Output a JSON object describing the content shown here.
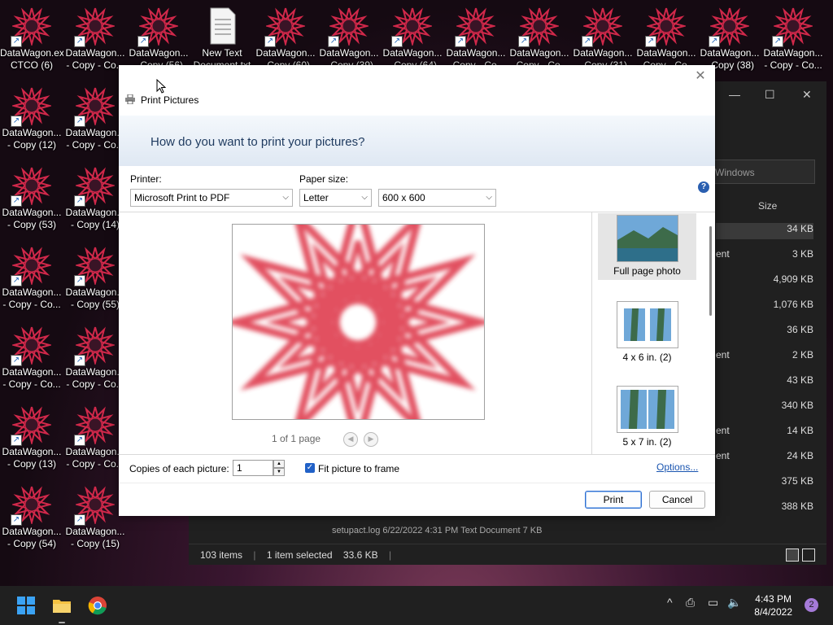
{
  "desktop": {
    "icons": [
      {
        "label": "DataWagon.ex\nCTCO (6)",
        "kind": "star"
      },
      {
        "label": "DataWagon...\n- Copy - Co...",
        "kind": "star"
      },
      {
        "label": "DataWagon...\n- Copy (56)",
        "kind": "star"
      },
      {
        "label": "New Text\nDocument.txt",
        "kind": "doc"
      },
      {
        "label": "DataWagon...\n- Copy (60)",
        "kind": "star"
      },
      {
        "label": "DataWagon...\n- Copy (39)",
        "kind": "star"
      },
      {
        "label": "DataWagon...\n- Copy (64)",
        "kind": "star"
      },
      {
        "label": "DataWagon...\n- Copy - Co...",
        "kind": "star"
      },
      {
        "label": "DataWagon...\n- Copy - Co...",
        "kind": "star"
      },
      {
        "label": "DataWagon...\n- Copy (31)",
        "kind": "star"
      },
      {
        "label": "DataWagon...\n- Copy - Co...",
        "kind": "star"
      },
      {
        "label": "DataWagon...\n- Copy (38)",
        "kind": "star"
      },
      {
        "label": "DataWagon...\n- Copy - Co...",
        "kind": "star"
      },
      {
        "label": "DataWagon...\n- Copy (12)",
        "kind": "star"
      },
      {
        "label": "DataWagon...\n- Copy - Co...",
        "kind": "star"
      },
      {
        "label": "DataWagon...\n- Copy (53)",
        "kind": "star"
      },
      {
        "label": "DataWagon...\n- Copy (14)",
        "kind": "star"
      },
      {
        "label": "DataWagon...\n- Copy - Co...",
        "kind": "star"
      },
      {
        "label": "DataWagon...\n- Copy (55)",
        "kind": "star"
      },
      {
        "label": "DataWagon...\n- Copy - Co...",
        "kind": "star"
      },
      {
        "label": "DataWagon...\n- Copy - Co...",
        "kind": "star"
      },
      {
        "label": "DataWagon...\n- Copy (13)",
        "kind": "star"
      },
      {
        "label": "DataWagon...\n- Copy - Co...",
        "kind": "star"
      },
      {
        "label": "DataWagon...\n- Copy (54)",
        "kind": "star"
      },
      {
        "label": "DataWagon...\n- Copy (15)",
        "kind": "star"
      },
      {
        "label": "DataWagon...\n- Copy - Co...",
        "kind": "star"
      }
    ]
  },
  "explorer": {
    "search_placeholder": "Windows",
    "col_size": "Size",
    "rows": [
      {
        "type": "",
        "size": "34 KB",
        "selected": true
      },
      {
        "type": "ent",
        "size": "3 KB"
      },
      {
        "type": "",
        "size": "4,909 KB"
      },
      {
        "type": "",
        "size": "1,076 KB"
      },
      {
        "type": "",
        "size": "36 KB"
      },
      {
        "type": "ent",
        "size": "2 KB"
      },
      {
        "type": "",
        "size": "43 KB"
      },
      {
        "type": "",
        "size": "340 KB"
      },
      {
        "type": "ent",
        "size": "14 KB"
      },
      {
        "type": "ent",
        "size": "24 KB"
      },
      {
        "type": "",
        "size": "375 KB"
      },
      {
        "type": "",
        "size": "388 KB"
      }
    ],
    "partial_row": "setupact.log          6/22/2022 4:31 PM          Text Document          7 KB",
    "status": {
      "items": "103 items",
      "selected": "1 item selected",
      "size": "33.6 KB"
    }
  },
  "dialog": {
    "title": "Print Pictures",
    "question": "How do you want to print your pictures?",
    "printer_label": "Printer:",
    "printer_value": "Microsoft Print to PDF",
    "paper_label": "Paper size:",
    "paper_value": "Letter",
    "quality_value": "600 x 600",
    "page_count": "1 of 1 page",
    "layouts": [
      {
        "label": "Full page photo",
        "selected": true
      },
      {
        "label": "4 x 6 in. (2)",
        "selected": false
      },
      {
        "label": "5 x 7 in. (2)",
        "selected": false
      }
    ],
    "copies_label": "Copies of each picture:",
    "copies_value": "1",
    "fit_label": "Fit picture to frame",
    "fit_checked": true,
    "options_link": "Options...",
    "print_button": "Print",
    "cancel_button": "Cancel"
  },
  "taskbar": {
    "time": "4:43 PM",
    "date": "8/4/2022",
    "notifications": "2"
  },
  "colors": {
    "accent": "#2161c7",
    "desktop_star": "#d0284a"
  }
}
